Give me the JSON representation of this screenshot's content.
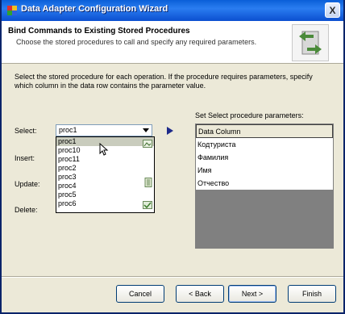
{
  "window": {
    "title": "Data Adapter Configuration Wizard",
    "close_label": "X"
  },
  "header": {
    "title": "Bind Commands to Existing Stored Procedures",
    "description": "Choose the stored procedures to call and specify any required parameters."
  },
  "main": {
    "instructions": "Select the stored procedure for each operation. If the procedure requires parameters, specify which column in the data row contains the parameter value.",
    "labels": {
      "select": "Select:",
      "insert": "Insert:",
      "update": "Update:",
      "delete": "Delete:"
    },
    "select_combo": {
      "value": "proc1"
    },
    "dropdown_options": [
      "proc1",
      "proc10",
      "proc11",
      "proc2",
      "proc3",
      "proc4",
      "proc5",
      "proc6"
    ],
    "dropdown_selected_index": 0,
    "params_label": "Set Select procedure parameters:",
    "params_grid": {
      "column_header": "Data Column",
      "rows": [
        "Кодтуриста",
        "Фамилия",
        "Имя",
        "Отчество"
      ]
    }
  },
  "buttons": {
    "cancel": "Cancel",
    "back": "< Back",
    "next": "Next >",
    "finish": "Finish"
  },
  "colors": {
    "titlebar": "#0a5fd8",
    "dialog_bg": "#ece9d8",
    "selection": "#c9ccbd",
    "grid_empty": "#808080"
  }
}
